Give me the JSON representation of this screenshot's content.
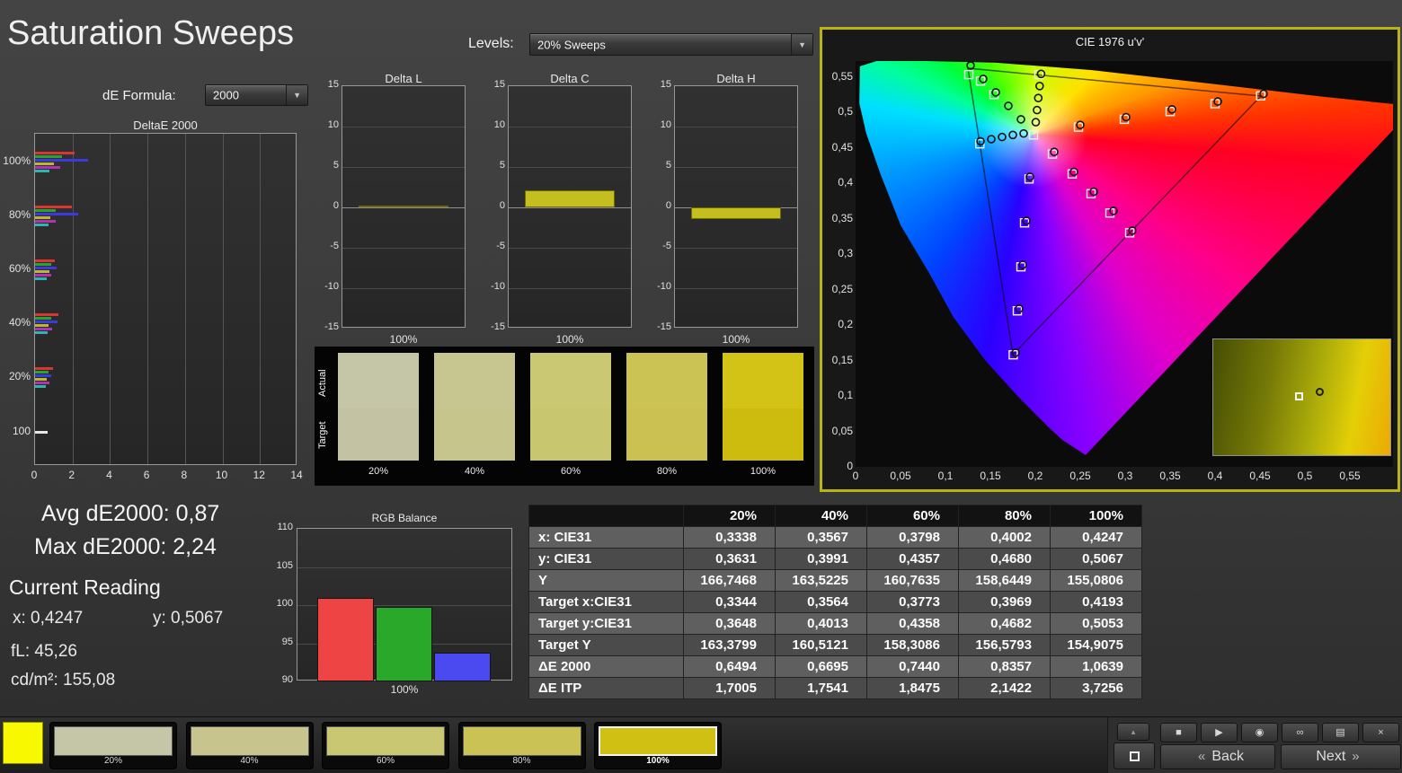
{
  "title": "Saturation Sweeps",
  "controls": {
    "de_formula_label": "dE Formula:",
    "de_formula_value": "2000",
    "levels_label": "Levels:",
    "levels_value": "20% Sweeps"
  },
  "deltae_chart": {
    "title": "DeltaE 2000",
    "categories": [
      "100%",
      "80%",
      "60%",
      "40%",
      "20%",
      "100"
    ],
    "xticks": [
      "0",
      "2",
      "4",
      "6",
      "8",
      "10",
      "12",
      "14"
    ],
    "xmax": 14,
    "bar_colors": [
      "#d93535",
      "#2da32d",
      "#3a3ae0",
      "#b9b92e",
      "#b232b2",
      "#2fb3b3"
    ],
    "white_bar_color": "#e8e8e8",
    "groups": [
      [
        2.1,
        1.45,
        2.85,
        1.0,
        1.35,
        0.75
      ],
      [
        1.95,
        1.1,
        2.3,
        0.8,
        1.1,
        0.7
      ],
      [
        1.05,
        0.85,
        1.15,
        0.75,
        0.85,
        0.6
      ],
      [
        1.25,
        0.85,
        1.2,
        0.7,
        0.9,
        0.65
      ],
      [
        0.95,
        0.7,
        0.85,
        0.6,
        0.75,
        0.55
      ],
      [
        0.65
      ]
    ]
  },
  "delta_axis": {
    "yticks": [
      "15",
      "10",
      "5",
      "0",
      "-5",
      "-10",
      "-15"
    ],
    "ymax": 15
  },
  "delta_charts": [
    {
      "title": "Delta L",
      "value": 0.2,
      "xlabel": "100%"
    },
    {
      "title": "Delta C",
      "value": 2.15,
      "xlabel": "100%"
    },
    {
      "title": "Delta H",
      "value": -1.4,
      "xlabel": "100%"
    }
  ],
  "swatch_strip": {
    "row_labels": [
      "Actual",
      "Target"
    ],
    "items": [
      {
        "label": "20%",
        "actual": "#c5c5a8",
        "target": "#c3c3a4"
      },
      {
        "label": "40%",
        "actual": "#c8c690",
        "target": "#c6c58c"
      },
      {
        "label": "60%",
        "actual": "#cac873",
        "target": "#c8c66f"
      },
      {
        "label": "80%",
        "actual": "#ccc355",
        "target": "#cac152"
      },
      {
        "label": "100%",
        "actual": "#d3c317",
        "target": "#cdbb0e"
      }
    ]
  },
  "cie": {
    "title": "CIE 1976 u'v'",
    "border_color": "#b9b411",
    "x_ticks": [
      "0",
      "0,05",
      "0,1",
      "0,15",
      "0,2",
      "0,25",
      "0,3",
      "0,35",
      "0,4",
      "0,45",
      "0,5",
      "0,55"
    ],
    "y_ticks": [
      "0",
      "0,05",
      "0,1",
      "0,15",
      "0,2",
      "0,25",
      "0,3",
      "0,35",
      "0,4",
      "0,45",
      "0,5",
      "0,55"
    ],
    "triangle": [
      [
        0.4507,
        0.5229
      ],
      [
        0.125,
        0.5625
      ],
      [
        0.1754,
        0.1579
      ]
    ],
    "white_point": [
      0.1978,
      0.4683
    ],
    "squares": [
      [
        0.126,
        0.553
      ],
      [
        0.139,
        0.544
      ],
      [
        0.154,
        0.525
      ],
      [
        0.1754,
        0.158
      ],
      [
        0.18,
        0.22
      ],
      [
        0.184,
        0.282
      ],
      [
        0.188,
        0.344
      ],
      [
        0.193,
        0.406
      ],
      [
        0.305,
        0.33
      ],
      [
        0.283,
        0.358
      ],
      [
        0.262,
        0.385
      ],
      [
        0.241,
        0.413
      ],
      [
        0.219,
        0.441
      ],
      [
        0.4507,
        0.523
      ],
      [
        0.4,
        0.512
      ],
      [
        0.35,
        0.501
      ],
      [
        0.299,
        0.49
      ],
      [
        0.248,
        0.479
      ],
      [
        0.204,
        0.553
      ],
      [
        0.198,
        0.468
      ],
      [
        0.1383,
        0.4555
      ]
    ],
    "circles": [
      [
        0.2005,
        0.486
      ],
      [
        0.2019,
        0.503
      ],
      [
        0.2033,
        0.52
      ],
      [
        0.2048,
        0.537
      ],
      [
        0.2064,
        0.554
      ],
      [
        0.187,
        0.47
      ],
      [
        0.175,
        0.468
      ],
      [
        0.163,
        0.465
      ],
      [
        0.151,
        0.462
      ],
      [
        0.139,
        0.459
      ],
      [
        0.184,
        0.49
      ],
      [
        0.17,
        0.509
      ],
      [
        0.156,
        0.528
      ],
      [
        0.142,
        0.547
      ],
      [
        0.128,
        0.566
      ],
      [
        0.25,
        0.482
      ],
      [
        0.301,
        0.493
      ],
      [
        0.352,
        0.504
      ],
      [
        0.403,
        0.515
      ],
      [
        0.454,
        0.526
      ],
      [
        0.221,
        0.444
      ],
      [
        0.243,
        0.416
      ],
      [
        0.265,
        0.388
      ],
      [
        0.287,
        0.361
      ],
      [
        0.308,
        0.333
      ],
      [
        0.194,
        0.409
      ],
      [
        0.19,
        0.347
      ],
      [
        0.186,
        0.285
      ],
      [
        0.182,
        0.223
      ],
      [
        0.178,
        0.161
      ]
    ],
    "inset_square": [
      46,
      46
    ],
    "inset_circle": [
      58,
      42
    ]
  },
  "stats": {
    "avg": "Avg dE2000: 0,87",
    "max": "Max dE2000: 2,24"
  },
  "current_reading": {
    "title": "Current Reading",
    "x": "x: 0,4247",
    "y": "y: 0,5067",
    "fl": "fL: 45,26",
    "cd": "cd/m²: 155,08"
  },
  "rgb_chart": {
    "title": "RGB Balance",
    "xlabel": "100%",
    "yticks": [
      "110",
      "105",
      "100",
      "95",
      "90"
    ],
    "ymin": 90,
    "ymax": 110,
    "values": [
      100.9,
      99.8,
      93.8
    ],
    "colors": [
      "#ee4444",
      "#2aa82a",
      "#4a4af0"
    ]
  },
  "table": {
    "headers": [
      "",
      "20%",
      "40%",
      "60%",
      "80%",
      "100%"
    ],
    "rows": [
      {
        "label": "x: CIE31",
        "values": [
          "0,3338",
          "0,3567",
          "0,3798",
          "0,4002",
          "0,4247"
        ]
      },
      {
        "label": "y: CIE31",
        "values": [
          "0,3631",
          "0,3991",
          "0,4357",
          "0,4680",
          "0,5067"
        ]
      },
      {
        "label": "Y",
        "values": [
          "166,7468",
          "163,5225",
          "160,7635",
          "158,6449",
          "155,0806"
        ]
      },
      {
        "label": "Target x:CIE31",
        "values": [
          "0,3344",
          "0,3564",
          "0,3773",
          "0,3969",
          "0,4193"
        ]
      },
      {
        "label": "Target y:CIE31",
        "values": [
          "0,3648",
          "0,4013",
          "0,4358",
          "0,4682",
          "0,5053"
        ]
      },
      {
        "label": "Target Y",
        "values": [
          "163,3799",
          "160,5121",
          "158,3086",
          "156,5793",
          "154,9075"
        ]
      },
      {
        "label": "ΔE 2000",
        "values": [
          "0,6494",
          "0,6695",
          "0,7440",
          "0,8357",
          "1,0639"
        ]
      },
      {
        "label": "ΔE ITP",
        "values": [
          "1,7005",
          "1,7541",
          "1,8475",
          "2,1422",
          "3,7256"
        ]
      }
    ]
  },
  "bottom_bar": {
    "current_color": "#f8f800",
    "swatches": [
      {
        "label": "20%",
        "color": "#c5c5a7",
        "selected": false
      },
      {
        "label": "40%",
        "color": "#c7c58d",
        "selected": false
      },
      {
        "label": "60%",
        "color": "#c9c772",
        "selected": false
      },
      {
        "label": "80%",
        "color": "#cbc256",
        "selected": false
      },
      {
        "label": "100%",
        "color": "#cfc013",
        "selected": true
      }
    ],
    "nav": {
      "collapse_glyph": "▴",
      "back_chevron": "«",
      "back_label": "Back",
      "next_label": "Next",
      "next_chevron": "»",
      "icon_buttons": [
        {
          "name": "stop-icon",
          "glyph": "■"
        },
        {
          "name": "play-icon",
          "glyph": "▶"
        },
        {
          "name": "record-icon",
          "glyph": "◉"
        },
        {
          "name": "loop-icon",
          "glyph": "∞"
        },
        {
          "name": "grid-icon",
          "glyph": "▤"
        },
        {
          "name": "close-icon",
          "glyph": "×"
        }
      ]
    }
  }
}
